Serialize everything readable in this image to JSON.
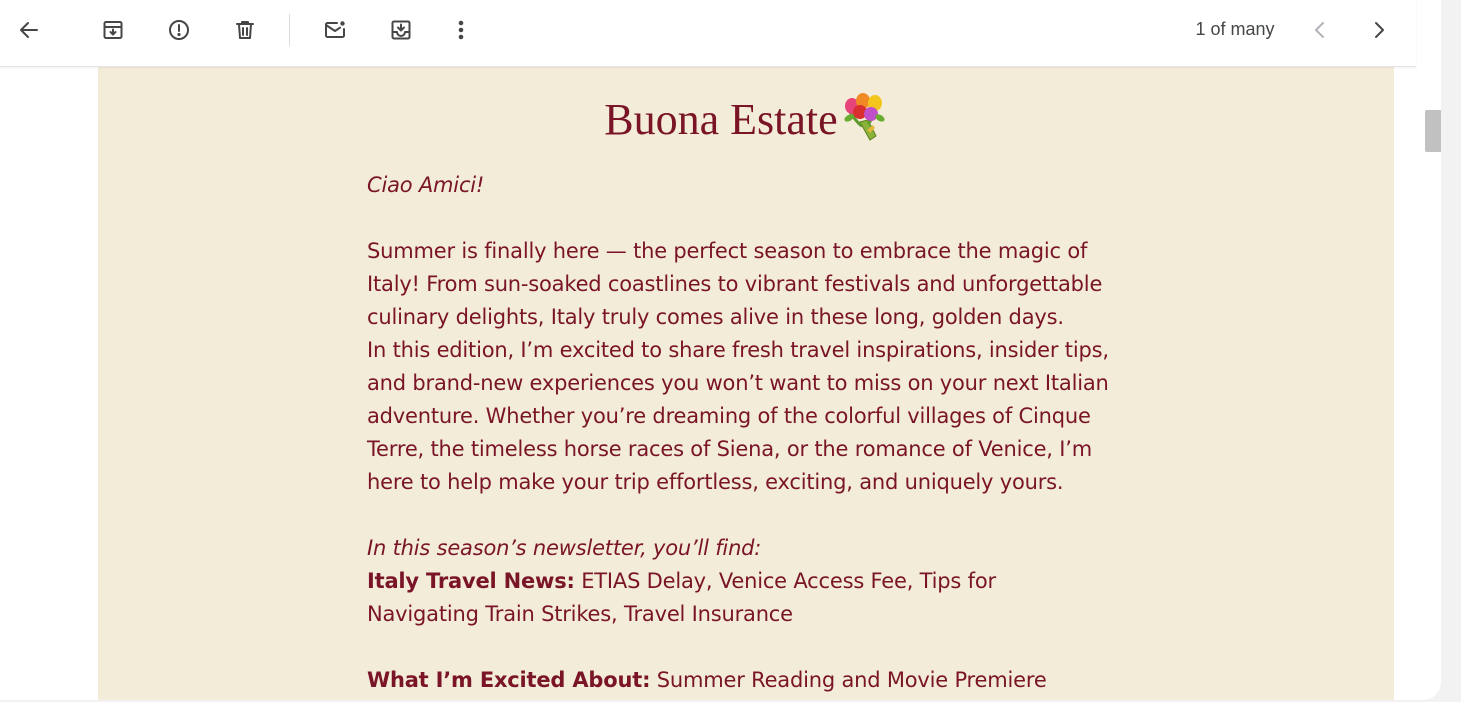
{
  "toolbar": {
    "icons": {
      "back": "arrow-left-icon",
      "archive": "archive-icon",
      "spam": "report-spam-icon",
      "delete": "trash-icon",
      "unread": "mark-unread-icon",
      "snooze": "move-to-inbox-icon",
      "more": "more-vertical-icon",
      "prev": "chevron-left-icon",
      "next": "chevron-right-icon"
    },
    "pager_text": "1 of many"
  },
  "email": {
    "heading": "Buona Estate",
    "heading_emoji": "bouquet-icon",
    "greeting": "Ciao Amici!",
    "intro": "Summer is finally here — the perfect season to embrace the magic of Italy! From sun-soaked coastlines to vibrant festivals and unforgettable culinary delights, Italy truly comes alive in these long, golden days.",
    "intro2": "In this edition, I’m excited to share fresh travel inspirations, insider tips, and brand-new experiences you won’t want to miss on your next Italian adventure. Whether you’re dreaming of the colorful villages of Cinque Terre, the timeless horse races of Siena, or the romance of Venice, I’m here to help make your trip effortless, exciting, and uniquely yours.",
    "find_intro": "In this season’s newsletter, you’ll find:",
    "sections": [
      {
        "label": "Italy Travel News:",
        "text": " ETIAS Delay, Venice Access Fee, Tips for Navigating Train Strikes, Travel Insurance"
      },
      {
        "label": "What I’m Excited About:",
        "text": " Summer Reading and Movie Premiere"
      }
    ]
  },
  "colors": {
    "email_background": "#f3ecd9",
    "text": "#7a1427",
    "toolbar_icon": "#444746"
  }
}
